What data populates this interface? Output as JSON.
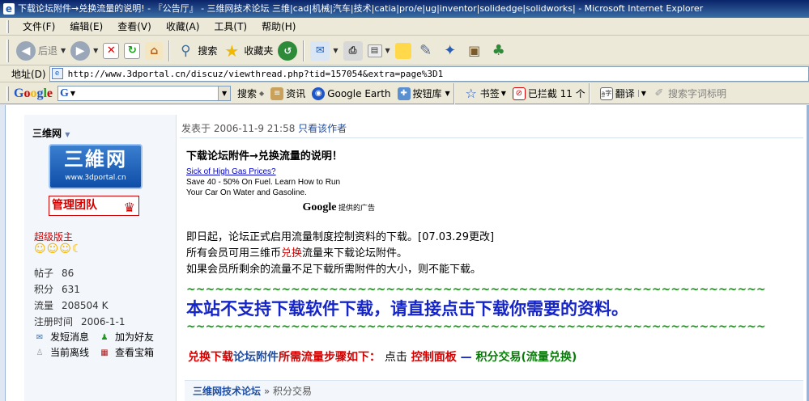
{
  "window": {
    "title": "下载论坛附件→兑换流量的说明! - 『公告厅』 - 三维网技术论坛 三维|cad|机械|汽车|技术|catia|pro/e|ug|inventor|solidedge|solidworks| - Microsoft Internet Explorer"
  },
  "menu": [
    "文件(F)",
    "编辑(E)",
    "查看(V)",
    "收藏(A)",
    "工具(T)",
    "帮助(H)"
  ],
  "toolbar": {
    "back": "后退",
    "search": "搜索",
    "favorites": "收藏夹"
  },
  "address": {
    "label": "地址(D)",
    "url": "http://www.3dportal.cn/discuz/viewthread.php?tid=157054&extra=page%3D1"
  },
  "googlebar": {
    "logo": "Google",
    "search_btn": "搜索",
    "news": "资讯",
    "earth": "Google Earth",
    "library": "按钮库",
    "bookmarks": "书签",
    "blocked": "已拦截 11 个",
    "translate": "翻译",
    "highlight": "搜索字词标明"
  },
  "sidebar": {
    "username": "三维网",
    "logo_big": "三維网",
    "logo_small": "www.3dportal.cn",
    "badge": "管理团队",
    "rank": "超级版主",
    "stats": [
      {
        "k": "帖子",
        "v": "86"
      },
      {
        "k": "积分",
        "v": "631"
      },
      {
        "k": "流量",
        "v": "208504 K"
      },
      {
        "k": "注册时间",
        "v": "2006-1-1"
      }
    ],
    "actions": {
      "pm": "发短消息",
      "add_friend": "加为好友",
      "offline": "当前离线",
      "treasure": "查看宝箱"
    }
  },
  "post": {
    "posted_prefix": "发表于",
    "datetime": "2006-11-9 21:58",
    "only_author": "只看该作者",
    "title": "下载论坛附件→兑换流量的说明！",
    "ad": {
      "link": "Sick of High Gas Prices?",
      "line1": "Save 40 - 50% On Fuel. Learn How to Run",
      "line2": "Your Car On Water and Gasoline.",
      "google": "Google",
      "provided": "提供的广告"
    },
    "line1": "即日起，论坛正式启用流量制度控制资料的下载。[07.03.29更改]",
    "line2a": "所有会员可用三维币",
    "line2b": "兑换",
    "line2c": "流量来下载论坛附件。",
    "line3": "如果会员所剩余的流量不足下载所需附件的大小，则不能下载。",
    "wave": "~~~~~~~~~~~~~~~~~~~~~~~~~~~~~~~~~~~~~~~~~~~~~~~~~~~~~~~~~~~~~",
    "big": "本站不支持下载软件下载，请直接点击下载你需要的资料。",
    "step_a": "兑换下载",
    "step_b": "论坛附件",
    "step_c": "所需流量步骤如下：",
    "step_d": "点击",
    "step_e": "控制面板",
    "step_f": "—",
    "step_g": "积分交易",
    "step_h": "(流量兑换)"
  },
  "breadcrumb": {
    "forum": "三维网技术论坛",
    "sub": "积分交易"
  }
}
